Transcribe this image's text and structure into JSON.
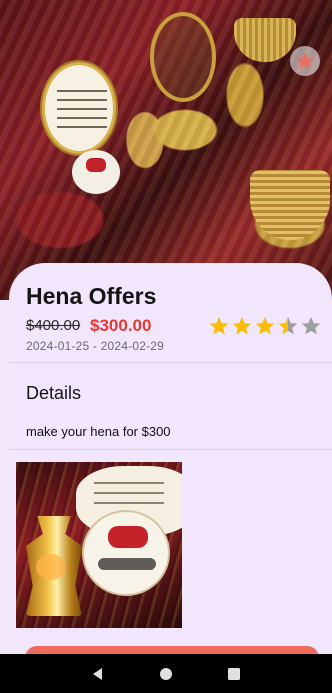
{
  "offer": {
    "title": "Hena Offers",
    "old_price": "$400.00",
    "new_price": "$300.00",
    "dates": "2024-01-25 - 2024-02-29",
    "rating": 3.5,
    "rating_max": 5
  },
  "details": {
    "heading": "Details",
    "description": "make your hena for $300"
  },
  "colors": {
    "background": "#f1e6fb",
    "price_accent": "#e53935",
    "star_filled": "#fbbc05",
    "star_empty": "#9e9e9e",
    "cta": "#ef6c5a",
    "favorite": "#ef6c5a"
  },
  "icons": {
    "favorite": "star-icon",
    "nav_back": "triangle-back-icon",
    "nav_home": "circle-home-icon",
    "nav_recents": "square-recents-icon"
  }
}
